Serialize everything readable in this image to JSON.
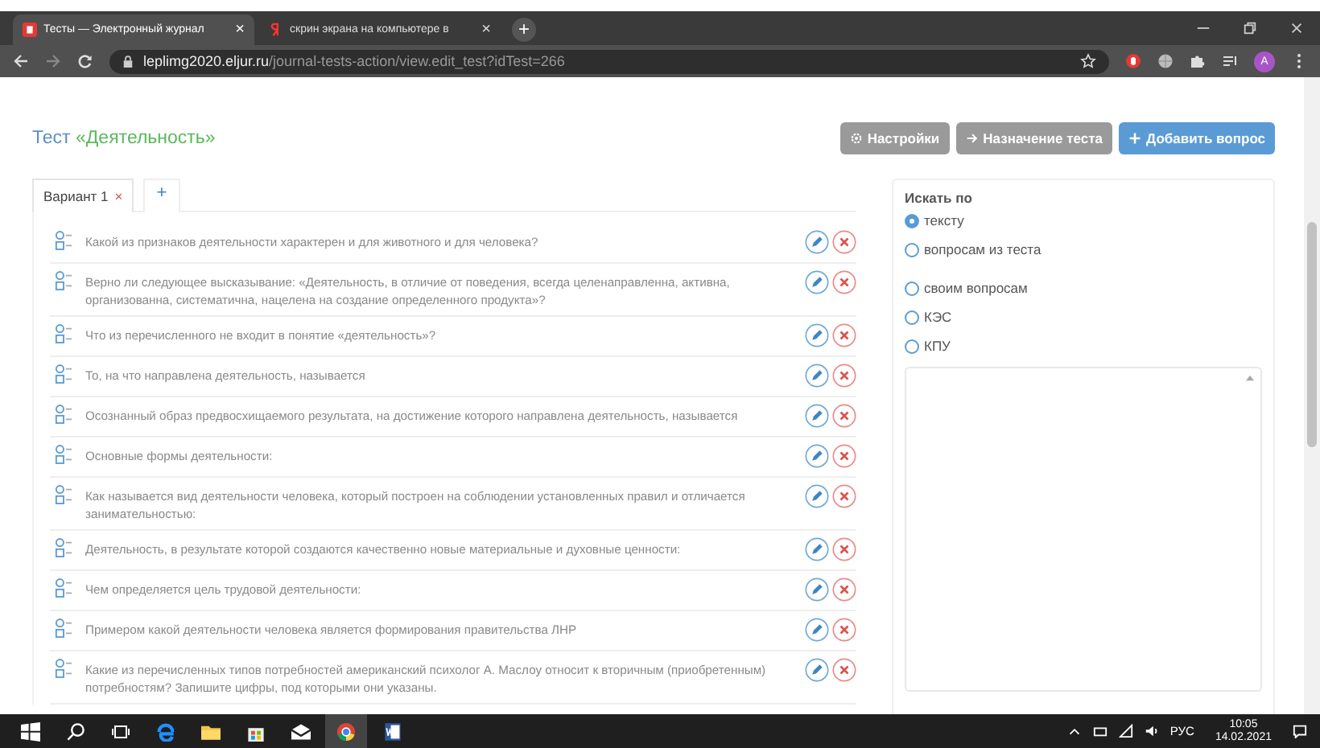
{
  "browser": {
    "tabs": [
      {
        "title": "Тесты — Электронный журнал",
        "close": "×",
        "selected": true
      },
      {
        "title": "скрин экрана на компьютере в",
        "close": "×",
        "selected": false
      }
    ],
    "new_tab": "+",
    "url_host": "leplimg2020.eljur.ru",
    "url_path": "/journal-tests-action/view.edit_test?idTest=266",
    "profile": "A"
  },
  "page": {
    "title_prefix": "Тест",
    "title_name": "«Деятельность»",
    "buttons": [
      {
        "label": "Настройки",
        "kind": "settings"
      },
      {
        "label": "Назначение теста",
        "kind": "assign"
      },
      {
        "label": "Добавить вопрос",
        "kind": "add"
      }
    ],
    "variant_tabs": [
      {
        "label": "Вариант 1",
        "close": "×",
        "selected": true
      },
      {
        "label": "+",
        "selected": false
      }
    ],
    "questions": [
      {
        "text": "Какой из признаков деятельности характерен и для животного и для человека?"
      },
      {
        "text": "Верно ли следующее высказывание: «Деятельность, в отличие от поведения, всегда целенаправленна, активна, организованна, систематична, нацелена на создание определенного продукта»?"
      },
      {
        "text": "Что из перечисленного не входит в понятие «деятельность»?"
      },
      {
        "text": "То, на что направлена деятельность, называется"
      },
      {
        "text": "Осознанный образ предвосхищаемого результата, на достижение которого направлена деятельность, называется"
      },
      {
        "text": "Основные формы деятельности:"
      },
      {
        "text": "Как называется вид деятельности человека, который построен на соблюдении установленных правил и отличается занимательностью:"
      },
      {
        "text": "Деятельность, в результате которой создаются качественно новые материальные и духовные ценности:"
      },
      {
        "text": "Чем определяется цель трудовой деятельности:"
      },
      {
        "text": "Примером какой деятельности человека является формирования правительства ЛНР"
      },
      {
        "text": "Какие из перечисленных типов потребностей американский психолог А. Маслоу относит к вторичным (приобретенным) потребностям? Запишите цифры, под которыми они указаны."
      }
    ],
    "search": {
      "label": "Искать по",
      "options": [
        {
          "label": "тексту",
          "selected": true
        },
        {
          "label": "вопросам из теста",
          "selected": false
        },
        {
          "label": "своим вопросам",
          "selected": false
        },
        {
          "label": "КЭС",
          "selected": false
        },
        {
          "label": "КПУ",
          "selected": false
        }
      ]
    }
  },
  "taskbar": {
    "language": "РУС",
    "time": "10:05",
    "date": "14.02.2021"
  }
}
